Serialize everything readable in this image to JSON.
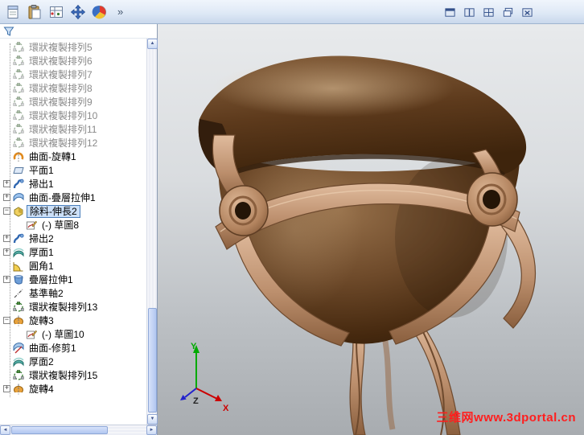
{
  "toolbar": {
    "left_icons": [
      "document-icon",
      "paste-icon",
      "design-table-icon",
      "move-icon",
      "color-wheel-icon"
    ],
    "overflow_label": "»",
    "right_icons": [
      "window-pane-icon",
      "split-view-icon",
      "grid-view-icon",
      "cascade-window-icon",
      "close-window-icon"
    ]
  },
  "panel": {
    "filter_icon": "filter-icon"
  },
  "tree": {
    "items": [
      {
        "label": "環狀複製排列5",
        "icon": "circular-pattern-icon",
        "muted": true
      },
      {
        "label": "環狀複製排列6",
        "icon": "circular-pattern-icon",
        "muted": true
      },
      {
        "label": "環狀複製排列7",
        "icon": "circular-pattern-icon",
        "muted": true
      },
      {
        "label": "環狀複製排列8",
        "icon": "circular-pattern-icon",
        "muted": true
      },
      {
        "label": "環狀複製排列9",
        "icon": "circular-pattern-icon",
        "muted": true
      },
      {
        "label": "環狀複製排列10",
        "icon": "circular-pattern-icon",
        "muted": true
      },
      {
        "label": "環狀複製排列11",
        "icon": "circular-pattern-icon",
        "muted": true
      },
      {
        "label": "環狀複製排列12",
        "icon": "circular-pattern-icon",
        "muted": true
      },
      {
        "label": "曲面-旋轉1",
        "icon": "surface-revolve-icon"
      },
      {
        "label": "平面1",
        "icon": "plane-icon"
      },
      {
        "label": "掃出1",
        "icon": "sweep-icon",
        "expander": "plus"
      },
      {
        "label": "曲面-疊層拉伸1",
        "icon": "surface-loft-icon",
        "expander": "plus"
      },
      {
        "label": "除料-伸長2",
        "icon": "cut-extrude-icon",
        "expander": "minus",
        "selected": true
      },
      {
        "label": "(-) 草圖8",
        "icon": "sketch-icon",
        "child": true
      },
      {
        "label": "掃出2",
        "icon": "sweep-icon",
        "expander": "plus"
      },
      {
        "label": "厚面1",
        "icon": "thicken-icon",
        "expander": "plus"
      },
      {
        "label": "圓角1",
        "icon": "fillet-icon"
      },
      {
        "label": "疊層拉伸1",
        "icon": "loft-icon",
        "expander": "plus"
      },
      {
        "label": "基準軸2",
        "icon": "axis-icon"
      },
      {
        "label": "環狀複製排列13",
        "icon": "circular-pattern-icon"
      },
      {
        "label": "旋轉3",
        "icon": "revolve-icon",
        "expander": "minus"
      },
      {
        "label": "(-) 草圖10",
        "icon": "sketch-icon",
        "child": true
      },
      {
        "label": "曲面-修剪1",
        "icon": "surface-trim-icon"
      },
      {
        "label": "厚面2",
        "icon": "thicken-icon"
      },
      {
        "label": "環狀複製排列15",
        "icon": "circular-pattern-icon"
      },
      {
        "label": "旋轉4",
        "icon": "revolve-icon",
        "expander": "plus"
      }
    ]
  },
  "viewport": {
    "watermark": "三维网www.3dportal.cn",
    "triad": {
      "x_label": "X",
      "y_label": "Y",
      "z_label": "Z"
    }
  },
  "colors": {
    "model_body_brown": "#6e4a2a",
    "model_trim_copper": "#c49a78",
    "watermark_red": "#ff1e1e",
    "selection_blue": "#4a7ebb",
    "axis_x_red": "#cc0000",
    "axis_y_green": "#00aa00",
    "axis_z_blue": "#2222cc"
  }
}
